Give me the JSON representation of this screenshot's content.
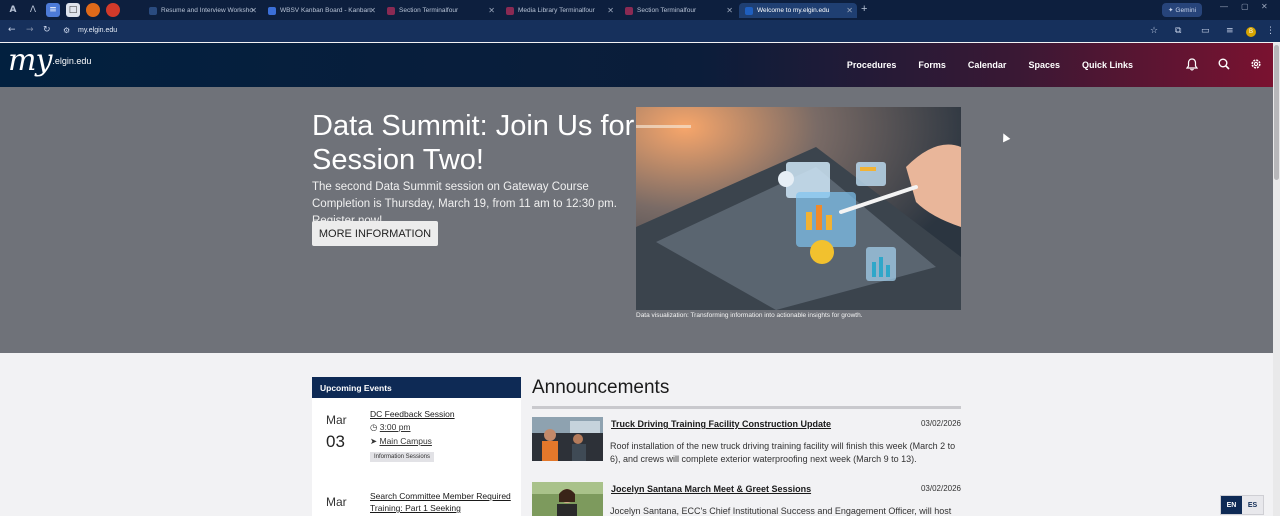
{
  "browser": {
    "tabs": [
      {
        "title": "Resume and Interview Worksho",
        "color": "#2a4b7f"
      },
      {
        "title": "WBSV Kanban Board - Kanban",
        "color": "#3b6fd8"
      },
      {
        "title": "Section Terminalfour",
        "color": "#8a2a53"
      },
      {
        "title": "Media Library Terminalfour",
        "color": "#8a2a53"
      },
      {
        "title": "Section Terminalfour",
        "color": "#8a2a53"
      },
      {
        "title": "Welcome to my.elgin.edu",
        "color": "#1f5fbf"
      }
    ],
    "address": "my.elgin.edu",
    "gemini_label": "Gemini",
    "profile_initial": "B"
  },
  "header": {
    "logo_my": "my",
    "logo_domain": ".elgin.edu",
    "nav": [
      "Procedures",
      "Forms",
      "Calendar",
      "Spaces",
      "Quick Links"
    ]
  },
  "hero": {
    "title": "Data Summit: Join Us for Session Two!",
    "description": "The second Data Summit session on Gateway Course Completion is Thursday, March 19, from 11 am to 12:30 pm. Register now!",
    "button": "MORE INFORMATION",
    "caption": "Data visualization: Transforming information into actionable insights for growth."
  },
  "events": {
    "heading": "Upcoming Events",
    "items": [
      {
        "month": "Mar",
        "day": "03",
        "title": "DC Feedback Session",
        "time": "3:00 pm",
        "location": "Main Campus",
        "tag": "Information Sessions"
      },
      {
        "month": "Mar",
        "day": "",
        "title": "Search Committee Member Required Training: Part 1 Seeking",
        "time": "",
        "location": "",
        "tag": ""
      }
    ]
  },
  "announcements": {
    "heading": "Announcements",
    "items": [
      {
        "title": "Truck Driving Training Facility Construction Update",
        "date": "03/02/2026",
        "body": "Roof installation of the new truck driving training facility will finish this week (March 2 to 6), and crews will complete exterior waterproofing next week (March 9 to 13)."
      },
      {
        "title": "Jocelyn Santana March Meet & Greet Sessions",
        "date": "03/02/2026",
        "body": "Jocelyn Santana, ECC's Chief Institutional Success and Engagement Officer, will host"
      }
    ]
  },
  "language": {
    "en": "EN",
    "es": "ES"
  }
}
